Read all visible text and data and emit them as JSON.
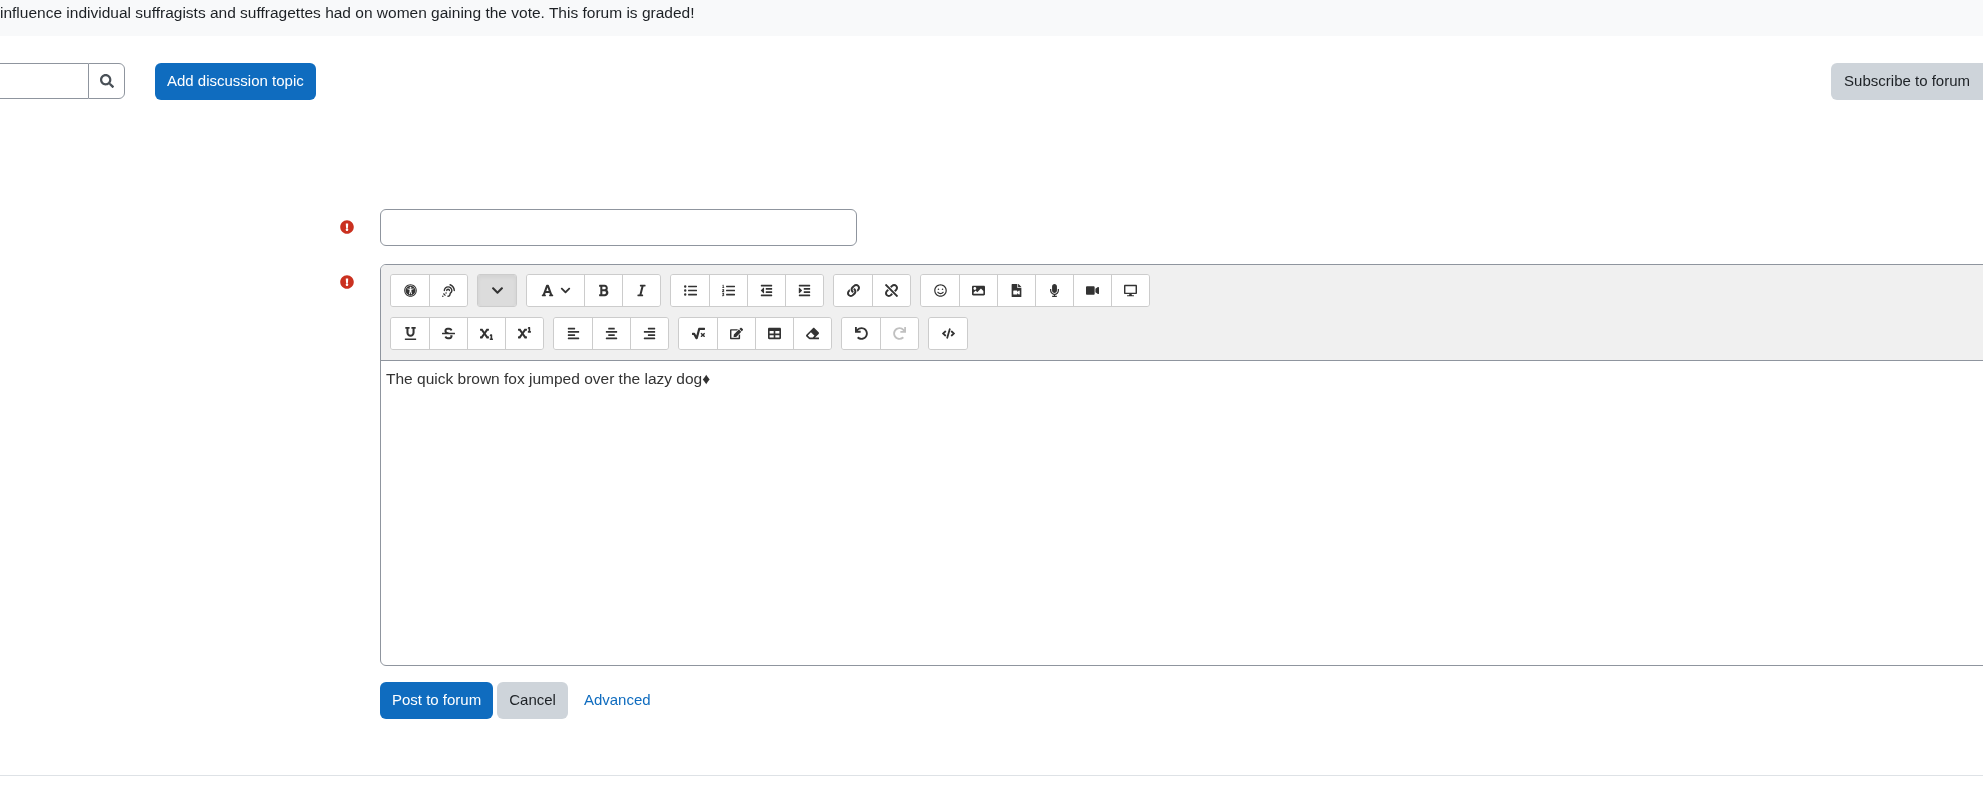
{
  "intro": {
    "text": "influence individual suffragists and suffragettes had on women gaining the vote. This forum is graded!"
  },
  "actions": {
    "add_button": "Add discussion topic",
    "subscribe_button": "Subscribe to forum"
  },
  "form": {
    "subject": {
      "required": true
    },
    "message": {
      "required": true,
      "toolbar_rows": [
        [
          [
            {
              "kind": "accessibility",
              "disabled": false,
              "expanded": false
            },
            {
              "kind": "screenreader",
              "disabled": false,
              "expanded": false
            }
          ],
          [
            {
              "kind": "more",
              "disabled": false,
              "expanded": true
            }
          ],
          [
            {
              "kind": "font",
              "disabled": false,
              "expanded": false
            },
            {
              "kind": "bold",
              "disabled": false,
              "expanded": false
            },
            {
              "kind": "italic",
              "disabled": false,
              "expanded": false
            }
          ],
          [
            {
              "kind": "bullets",
              "disabled": false,
              "expanded": false
            },
            {
              "kind": "numbers",
              "disabled": false,
              "expanded": false
            },
            {
              "kind": "outdent",
              "disabled": false,
              "expanded": false
            },
            {
              "kind": "indent",
              "disabled": false,
              "expanded": false
            }
          ],
          [
            {
              "kind": "link",
              "disabled": false,
              "expanded": false
            },
            {
              "kind": "unlink",
              "disabled": false,
              "expanded": false
            }
          ],
          [
            {
              "kind": "emoji",
              "disabled": false,
              "expanded": false
            },
            {
              "kind": "image",
              "disabled": false,
              "expanded": false
            },
            {
              "kind": "media",
              "disabled": false,
              "expanded": false
            },
            {
              "kind": "audio",
              "disabled": false,
              "expanded": false
            },
            {
              "kind": "video",
              "disabled": false,
              "expanded": false
            },
            {
              "kind": "devices",
              "disabled": false,
              "expanded": false
            }
          ]
        ],
        [
          [
            {
              "kind": "underline",
              "disabled": false,
              "expanded": false
            },
            {
              "kind": "strike",
              "disabled": false,
              "expanded": false
            },
            {
              "kind": "subscript",
              "disabled": false,
              "expanded": false
            },
            {
              "kind": "superscript",
              "disabled": false,
              "expanded": false
            }
          ],
          [
            {
              "kind": "align_left",
              "disabled": false,
              "expanded": false
            },
            {
              "kind": "align_center",
              "disabled": false,
              "expanded": false
            },
            {
              "kind": "align_right",
              "disabled": false,
              "expanded": false
            }
          ],
          [
            {
              "kind": "equation",
              "disabled": false,
              "expanded": false
            },
            {
              "kind": "edit",
              "disabled": false,
              "expanded": false
            },
            {
              "kind": "table",
              "disabled": false,
              "expanded": false
            },
            {
              "kind": "clear",
              "disabled": false,
              "expanded": false
            }
          ],
          [
            {
              "kind": "undo",
              "disabled": false,
              "expanded": false
            },
            {
              "kind": "redo",
              "disabled": true,
              "expanded": false
            }
          ],
          [
            {
              "kind": "html",
              "disabled": false,
              "expanded": false
            }
          ]
        ]
      ],
      "content": "The quick brown fox jumped over the lazy dog♦"
    },
    "buttons": [
      {
        "kind": "primary",
        "label": "Post to forum"
      },
      {
        "kind": "secondary",
        "label": "Cancel"
      },
      {
        "kind": "link",
        "label": "Advanced"
      }
    ]
  }
}
